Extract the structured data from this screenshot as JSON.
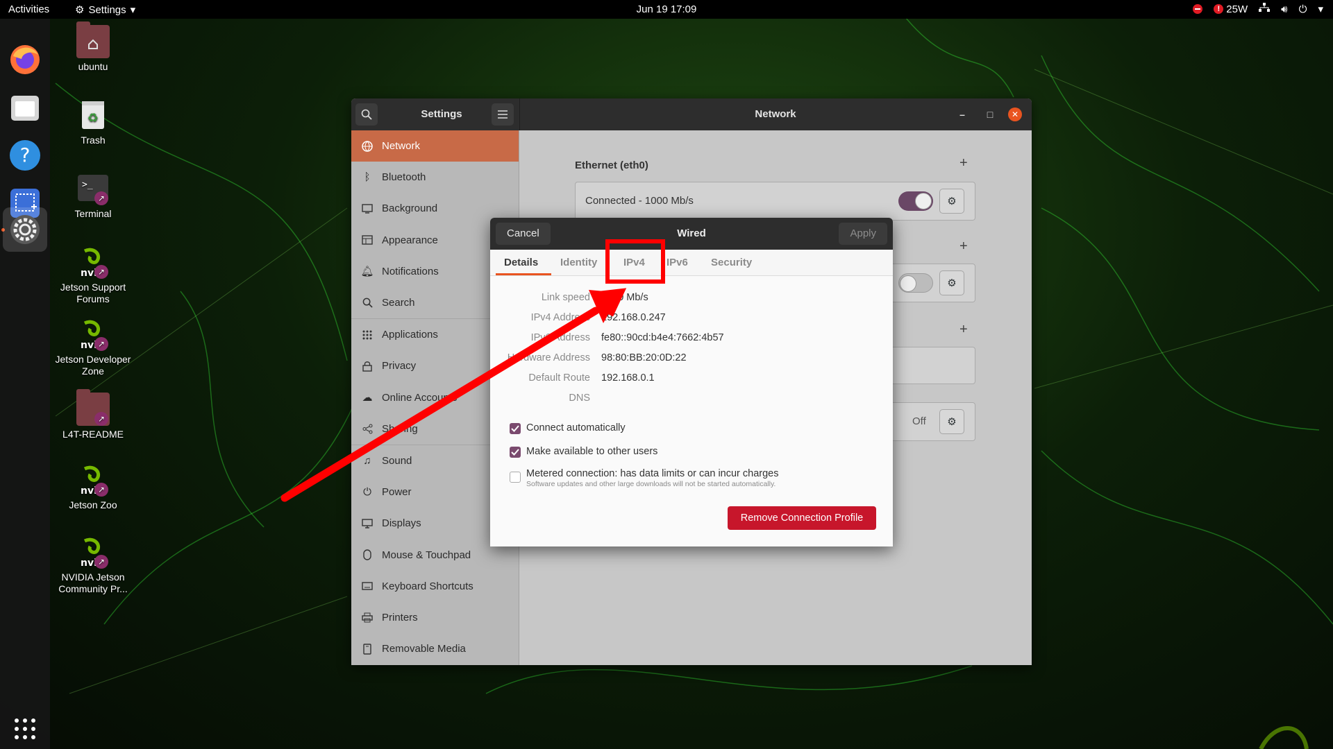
{
  "topbar": {
    "activities": "Activities",
    "app_menu": "Settings",
    "clock": "Jun 19  17:09",
    "power_label": "25W"
  },
  "desktop_icons": [
    {
      "label": "ubuntu",
      "icon": "home-folder-icon"
    },
    {
      "label": "Trash",
      "icon": "trash-icon"
    },
    {
      "label": "Terminal",
      "icon": "terminal-icon"
    },
    {
      "label": "Jetson Support Forums",
      "icon": "nvidia-icon"
    },
    {
      "label": "Jetson Developer Zone",
      "icon": "nvidia-icon"
    },
    {
      "label": "L4T-README",
      "icon": "folder-icon"
    },
    {
      "label": "Jetson Zoo",
      "icon": "nvidia-icon"
    },
    {
      "label": "NVIDIA Jetson Community Pr...",
      "icon": "nvidia-icon"
    }
  ],
  "dock": [
    {
      "icon": "firefox-icon"
    },
    {
      "icon": "files-icon"
    },
    {
      "icon": "help-icon"
    },
    {
      "icon": "screenshot-icon"
    },
    {
      "icon": "settings-icon",
      "active": true
    },
    {
      "icon": "show-apps-icon"
    }
  ],
  "settings": {
    "left_title": "Settings",
    "main_title": "Network",
    "sidebar": [
      {
        "label": "Network",
        "icon": "network-icon",
        "active": true
      },
      {
        "label": "Bluetooth",
        "icon": "bluetooth-icon"
      },
      {
        "label": "Background",
        "icon": "background-icon"
      },
      {
        "label": "Appearance",
        "icon": "appearance-icon"
      },
      {
        "label": "Notifications",
        "icon": "bell-icon"
      },
      {
        "label": "Search",
        "icon": "search-icon"
      },
      {
        "label": "Applications",
        "icon": "apps-grid-icon"
      },
      {
        "label": "Privacy",
        "icon": "lock-icon"
      },
      {
        "label": "Online Accounts",
        "icon": "cloud-icon"
      },
      {
        "label": "Sharing",
        "icon": "share-icon"
      },
      {
        "label": "Sound",
        "icon": "music-note-icon"
      },
      {
        "label": "Power",
        "icon": "power-icon"
      },
      {
        "label": "Displays",
        "icon": "display-icon"
      },
      {
        "label": "Mouse & Touchpad",
        "icon": "mouse-icon"
      },
      {
        "label": "Keyboard Shortcuts",
        "icon": "keyboard-icon"
      },
      {
        "label": "Printers",
        "icon": "printer-icon"
      },
      {
        "label": "Removable Media",
        "icon": "removable-media-icon"
      }
    ],
    "ethernet_title": "Ethernet (eth0)",
    "ethernet_status": "Connected - 1000 Mb/s",
    "proxy_status": "Off"
  },
  "dialog": {
    "title": "Wired",
    "cancel": "Cancel",
    "apply": "Apply",
    "tabs": [
      "Details",
      "Identity",
      "IPv4",
      "IPv6",
      "Security"
    ],
    "active_tab": "Details",
    "details": [
      {
        "key": "Link speed",
        "value": "1000 Mb/s"
      },
      {
        "key": "IPv4 Address",
        "value": "192.168.0.247"
      },
      {
        "key": "IPv6 Address",
        "value": "fe80::90cd:b4e4:7662:4b57"
      },
      {
        "key": "Hardware Address",
        "value": "98:80:BB:20:0D:22"
      },
      {
        "key": "Default Route",
        "value": "192.168.0.1"
      },
      {
        "key": "DNS",
        "value": ""
      }
    ],
    "connect_automatically": "Connect automatically",
    "available_to_others": "Make available to other users",
    "metered": "Metered connection: has data limits or can incur charges",
    "metered_note": "Software updates and other large downloads will not be started automatically.",
    "remove": "Remove Connection Profile"
  },
  "colors": {
    "accent": "#e95420",
    "annotation": "#ff0000",
    "remove_button": "#c7162b"
  }
}
